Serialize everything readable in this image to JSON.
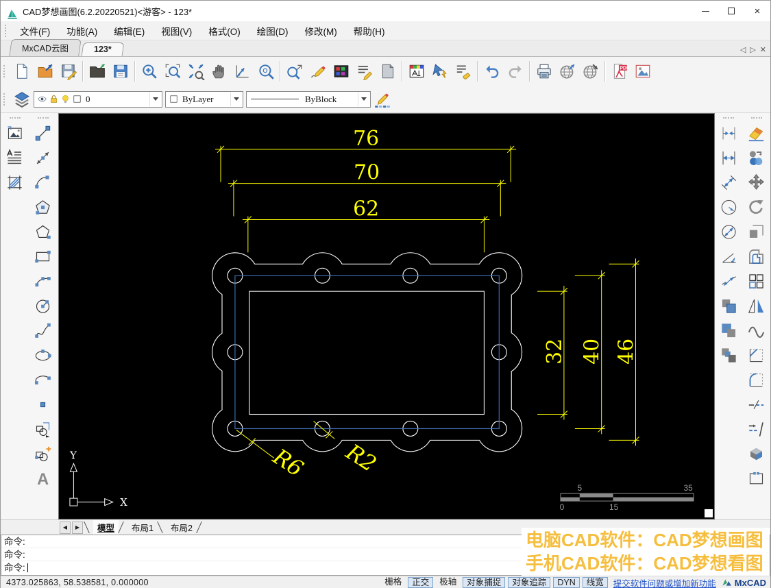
{
  "window": {
    "title": "CAD梦想画图(6.2.20220521)<游客> - 123*"
  },
  "menu": {
    "items": [
      {
        "name": "file",
        "label": "文件(F)"
      },
      {
        "name": "function",
        "label": "功能(A)"
      },
      {
        "name": "edit",
        "label": "编辑(E)"
      },
      {
        "name": "view",
        "label": "视图(V)"
      },
      {
        "name": "format",
        "label": "格式(O)"
      },
      {
        "name": "draw",
        "label": "绘图(D)"
      },
      {
        "name": "modify",
        "label": "修改(M)"
      },
      {
        "name": "help",
        "label": "帮助(H)"
      }
    ]
  },
  "doc_tabs": {
    "items": [
      {
        "name": "mxcad-cloud",
        "label": "MxCAD云图",
        "active": false
      },
      {
        "name": "drawing-123",
        "label": "123*",
        "active": true
      }
    ]
  },
  "toolbar_main": {
    "items": [
      "new-file",
      "open-drawing",
      "save",
      "sep",
      "open-folder",
      "save-as",
      "sep",
      "zoom-in",
      "zoom-window",
      "zoom-extents",
      "pan",
      "zoom-previous",
      "zoom-all",
      "sep",
      "named-view",
      "sketch",
      "color-palette",
      "text-edit",
      "page-setup",
      "sep",
      "layer-settings",
      "quick-select",
      "match-properties",
      "sep",
      "undo",
      "redo",
      "sep",
      "print",
      "web-upload",
      "web-download",
      "sep",
      "pdf-export",
      "image-export"
    ]
  },
  "properties_toolbar": {
    "layer": "0",
    "color": "ByLayer",
    "linetype": "ByBlock"
  },
  "left_toolbar": {
    "col1": [
      "insert-image",
      "mtext",
      "hatch"
    ],
    "col2": [
      "line",
      "xline",
      "arc",
      "polygon-filled",
      "polygon",
      "rectangle",
      "arc-3pt",
      "circle",
      "spline",
      "ellipse",
      "ellipse-arc",
      "point",
      "copy-block",
      "insert-block",
      "text"
    ]
  },
  "right_toolbar": {
    "col1": [
      "dim-quick",
      "dim-linear",
      "dim-aligned",
      "dim-radius",
      "dim-diameter",
      "dim-angular",
      "dim-jogged",
      "copy-props",
      "copy-props-2",
      "copy-props-3"
    ],
    "col2": [
      "erase",
      "copy",
      "move",
      "rotate",
      "scale",
      "offset",
      "array",
      "mirror",
      "fit-curve",
      "chamfer",
      "fillet",
      "break",
      "trim",
      "box-3d",
      "break-point"
    ]
  },
  "drawing": {
    "dim_h": [
      "76",
      "70",
      "62"
    ],
    "dim_v": [
      "32",
      "40",
      "46"
    ],
    "radius_labels": [
      "R6",
      "R2"
    ],
    "ucs": {
      "x": "X",
      "y": "Y"
    },
    "scalebar": {
      "above": [
        "5",
        "35"
      ],
      "below": [
        "0",
        "15"
      ]
    },
    "colors": {
      "background": "#000000",
      "geometry": "#ffffff",
      "dimension": "#ffff00",
      "frame": "#3d6eb0"
    }
  },
  "layout_tabs": {
    "items": [
      {
        "name": "model",
        "label": "模型",
        "active": true
      },
      {
        "name": "layout1",
        "label": "布局1",
        "active": false
      },
      {
        "name": "layout2",
        "label": "布局2",
        "active": false
      }
    ]
  },
  "command": {
    "prompt_lines": [
      "命令:",
      "命令:",
      "命令:"
    ]
  },
  "status": {
    "coordinates": "4373.025863,  58.538581,  0.000000",
    "toggles": [
      {
        "name": "grid",
        "label": "栅格",
        "boxed": false
      },
      {
        "name": "ortho",
        "label": "正交",
        "boxed": true
      },
      {
        "name": "polar",
        "label": "极轴",
        "boxed": false
      },
      {
        "name": "osnap",
        "label": "对象捕捉",
        "boxed": true
      },
      {
        "name": "otrack",
        "label": "对象追踪",
        "boxed": true
      },
      {
        "name": "dyn",
        "label": "DYN",
        "boxed": true
      },
      {
        "name": "lineweight",
        "label": "线宽",
        "boxed": true
      }
    ],
    "feedback_link": "提交软件问题或增加新功能",
    "brand": "MxCAD"
  },
  "promo": {
    "line1": "电脑CAD软件：CAD梦想画图",
    "line2": "手机CAD软件：CAD梦想看图",
    "color": "#F6BE3E"
  }
}
